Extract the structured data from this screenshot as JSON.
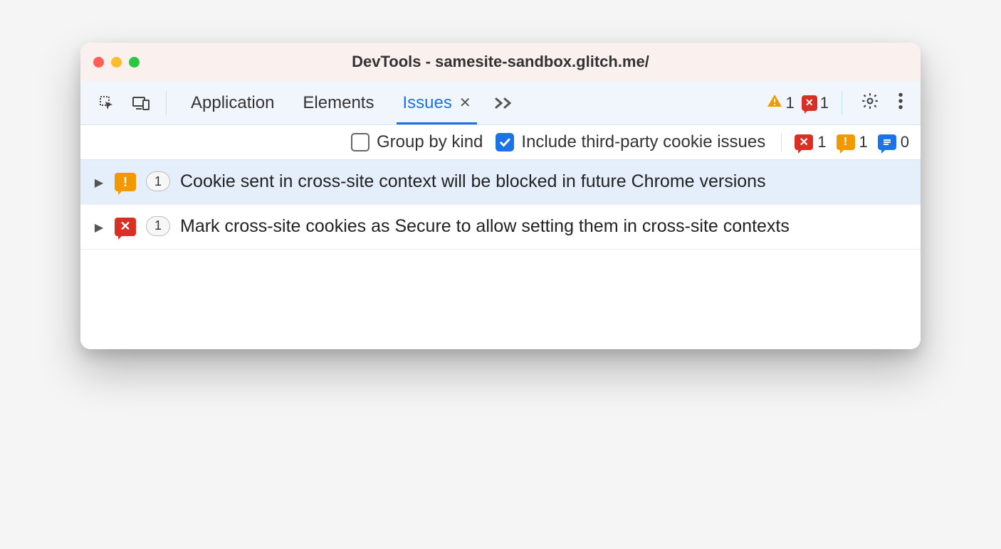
{
  "window": {
    "title": "DevTools - samesite-sandbox.glitch.me/"
  },
  "tabs": {
    "items": [
      {
        "label": "Application",
        "active": false
      },
      {
        "label": "Elements",
        "active": false
      },
      {
        "label": "Issues",
        "active": true
      }
    ]
  },
  "toolbar_badges": {
    "warnings": "1",
    "errors": "1"
  },
  "filters": {
    "group_by_kind": {
      "label": "Group by kind",
      "checked": false
    },
    "include_third_party": {
      "label": "Include third-party cookie issues",
      "checked": true
    }
  },
  "severity_counts": {
    "error": "1",
    "warning": "1",
    "info": "0"
  },
  "issues": [
    {
      "severity": "warning",
      "count": "1",
      "title": "Cookie sent in cross-site context will be blocked in future Chrome versions",
      "selected": true
    },
    {
      "severity": "error",
      "count": "1",
      "title": "Mark cross-site cookies as Secure to allow setting them in cross-site contexts",
      "selected": false
    }
  ]
}
